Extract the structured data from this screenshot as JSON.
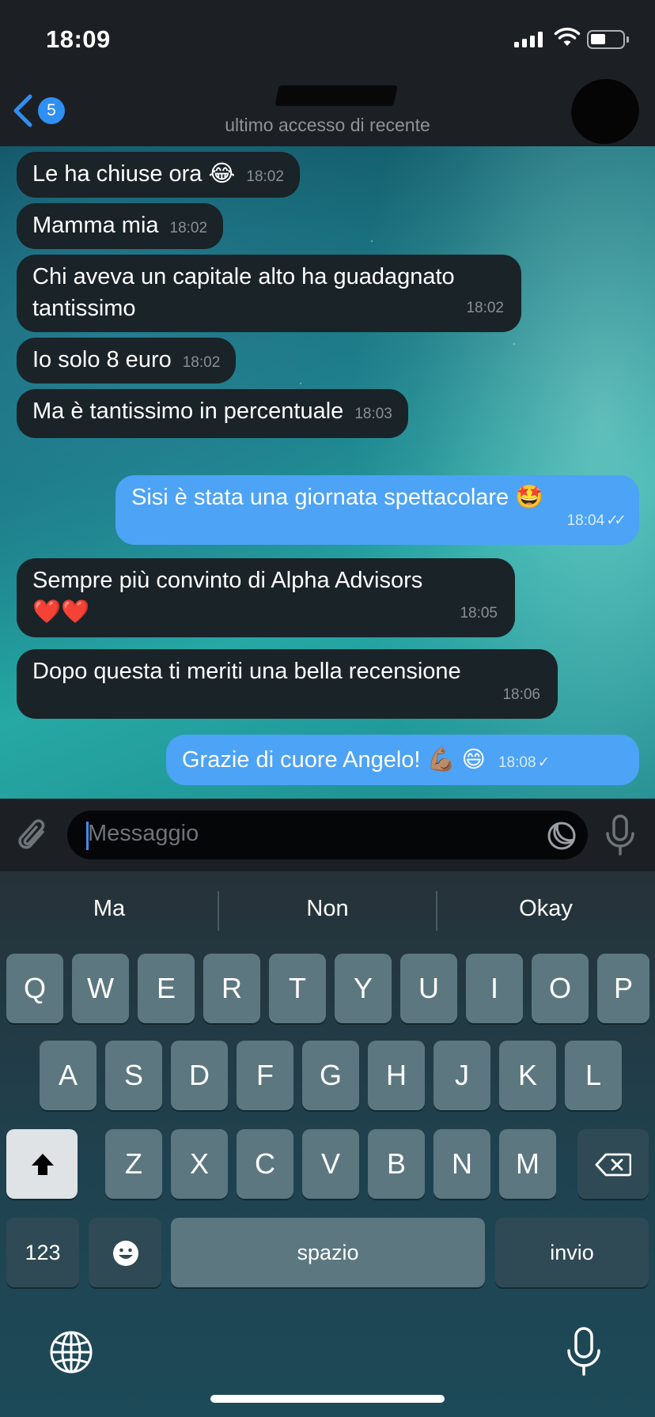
{
  "status_bar": {
    "time": "18:09"
  },
  "header": {
    "back_badge": "5",
    "subtitle": "ultimo accesso di recente"
  },
  "messages": [
    {
      "dir": "in",
      "text": "Le ha chiuse ora 😂",
      "time": "18:02"
    },
    {
      "dir": "in",
      "text": "Mamma mia",
      "time": "18:02"
    },
    {
      "dir": "in",
      "line1": "Chi aveva un capitale alto ha guadagnato",
      "line2": "tantissimo",
      "time": "18:02"
    },
    {
      "dir": "in",
      "text": "Io solo 8 euro",
      "time": "18:02"
    },
    {
      "dir": "in",
      "text": "Ma è tantissimo in percentuale",
      "time": "18:03"
    },
    {
      "dir": "out",
      "text": "Sisi è stata una giornata spettacolare 🤩",
      "time": "18:04",
      "ticks": "✓✓"
    },
    {
      "dir": "in",
      "line1": "Sempre più convinto di Alpha Advisors",
      "line2": "❤️❤️",
      "time": "18:05"
    },
    {
      "dir": "in",
      "text": "Dopo questa ti meriti una bella recensione",
      "time": "18:06"
    },
    {
      "dir": "out",
      "text": "Grazie di cuore Angelo! 💪🏽 😄",
      "time": "18:08",
      "ticks": "✓"
    }
  ],
  "input": {
    "placeholder": "Messaggio"
  },
  "keyboard": {
    "suggestions": [
      "Ma",
      "Non",
      "Okay"
    ],
    "row1": [
      "Q",
      "W",
      "E",
      "R",
      "T",
      "Y",
      "U",
      "I",
      "O",
      "P"
    ],
    "row2": [
      "A",
      "S",
      "D",
      "F",
      "G",
      "H",
      "J",
      "K",
      "L"
    ],
    "row3": [
      "Z",
      "X",
      "C",
      "V",
      "B",
      "N",
      "M"
    ],
    "numbers_label": "123",
    "space_label": "spazio",
    "return_label": "invio"
  },
  "icons": [
    "back-chevron-icon",
    "attach-icon",
    "sticker-icon",
    "microphone-icon",
    "shift-icon",
    "backspace-icon",
    "emoji-icon",
    "globe-icon",
    "dictation-icon"
  ],
  "colors": {
    "outgoing_bubble": "#4da3f5",
    "incoming_bubble": "#1a2327",
    "accent": "#2f8ff2"
  }
}
